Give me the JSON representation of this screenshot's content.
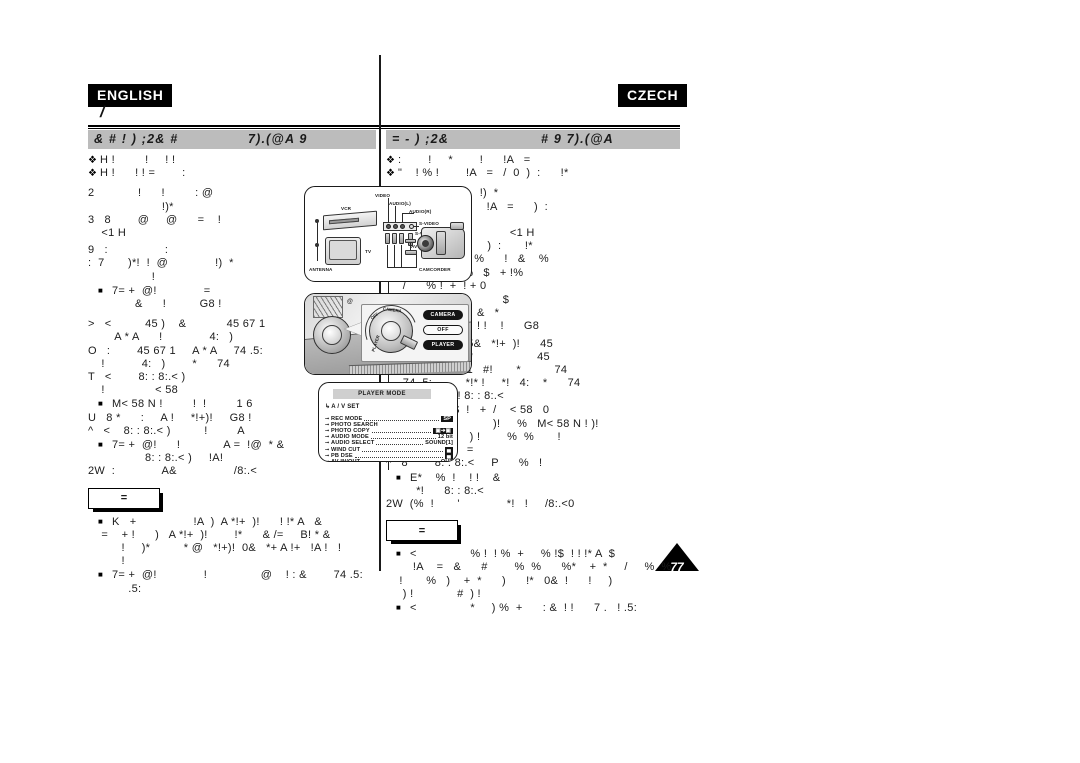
{
  "page": {
    "number": "77",
    "left_language_badge": "ENGLISH",
    "right_language_badge": "CZECH",
    "section_title": "/"
  },
  "left_column": {
    "header_main": "&  # !   )  ;2&   #",
    "header_sub": "7).(@A   9",
    "lines": [
      {
        "style": "bullet-d",
        "text": "H !         !     ! !"
      },
      {
        "style": "bullet-d",
        "text": "H !      ! ! =        :"
      },
      {
        "style": "gap",
        "text": "2             !      !         : @"
      },
      {
        "style": "plain",
        "text": "                      !)*"
      },
      {
        "style": "plain",
        "text": "3   8        @     @      =    !"
      },
      {
        "style": "plain",
        "text": "    <1 H"
      },
      {
        "style": "gap-s",
        "text": "9   :                 :"
      },
      {
        "style": "plain",
        "text": ":  7       )*!  !  @              !)  *"
      },
      {
        "style": "plain",
        "text": "                   !"
      },
      {
        "style": "bullet-sq",
        "text": "7= +  @!              ="
      },
      {
        "style": "plain",
        "text": "              &      !          G8 !"
      },
      {
        "style": "gap",
        "text": ">   <          45 )    &            45 67 1"
      },
      {
        "style": "plain",
        "text": "        A * A      !              4:   )"
      },
      {
        "style": "plain",
        "text": "O   :        45 67 1     A * A     74 .5:"
      },
      {
        "style": "plain",
        "text": "    !           4:   )        *      74"
      },
      {
        "style": "plain",
        "text": "T   <        8: : 8:.< )"
      },
      {
        "style": "plain",
        "text": "    !               < 58"
      },
      {
        "style": "bullet-sq",
        "text": "M< 58 N !         !  !         1 6"
      },
      {
        "style": "plain",
        "text": "U   8 *      :     A !     *!+)!     G8 !"
      },
      {
        "style": "plain",
        "text": "^   <    8: : 8:.< )          !         A"
      },
      {
        "style": "bullet-sq",
        "text": "7= +  @!      !             A =  !@  * &"
      },
      {
        "style": "plain",
        "text": "                 8: : 8:.< )     !A!"
      },
      {
        "style": "plain",
        "text": "2W  :              A&                 /8:.<"
      }
    ],
    "notes_label": "=",
    "notes_lines": [
      {
        "style": "bullet-sq",
        "text": "K   +                 !A  )  A *!+  )!      ! !* A   &"
      },
      {
        "style": "plain",
        "text": "    =    + !      )   A *!+  )!        !*      & /=     B! * &"
      },
      {
        "style": "plain",
        "text": "          !     )*          * @   *!+)!  0&   *+ A !+   !A !   !"
      },
      {
        "style": "plain",
        "text": "          !"
      },
      {
        "style": "bullet-sq",
        "text": "7= +  @!              !                @    ! : &        74 .5:"
      },
      {
        "style": "plain",
        "text": "            .5:"
      }
    ]
  },
  "right_column": {
    "header_main": "=           -    )  ;2&",
    "header_sub": "#  9 7).(@A",
    "lines": [
      {
        "style": "bullet-d",
        "text": ":        !     *        !      !A   ="
      },
      {
        "style": "bullet-d",
        "text": "\"    ! % !        !A   =   /  0  )  :      !*"
      },
      {
        "style": "gap",
        "text": "2   <                     !)  *"
      },
      {
        "style": "plain",
        "text": "                 !            !A   =      )  :"
      },
      {
        "style": "plain",
        "text": "             !*"
      },
      {
        "style": "plain",
        "text": "3        !                          <1 H"
      },
      {
        "style": "plain",
        "text": "9   (!          !A   =     )  :       !*"
      },
      {
        "style": "plain",
        "text": ":   6       !  + *      %      !   &    %"
      },
      {
        "style": "plain",
        "text": "            !   !      %   $   + !%"
      },
      {
        "style": "plain",
        "text": "     /      % !  +  ! + 0"
      },
      {
        "style": "bullet-sq",
        "text": "E*  !  % !              $"
      },
      {
        "style": "plain",
        "text": "              !A     =   &   *"
      },
      {
        "style": "plain",
        "text": "              !A    =    ! !    !      G8"
      },
      {
        "style": "gap-s",
        "text": ">     8        *!   45&   *!+  )!      45"
      },
      {
        "style": "plain",
        "text": "     67 1    #!      *                   45"
      },
      {
        "style": "plain",
        "text": "O   . %'   45 67 1   #!       *          74"
      },
      {
        "style": "plain",
        "text": "     74 .5:          *!* !     *!   4:    *      74"
      },
      {
        "style": "plain",
        "text": "T   8         *!   ! 8: : 8:.<"
      },
      {
        "style": "plain",
        "text": "          %   !   $  !   +  /    < 58   0"
      },
      {
        "style": "bullet-sq",
        "text": "4! 1 6                )!     %   M< 58 N ! )!"
      },
      {
        "style": "plain",
        "text": "U   ( *  :     A !    ) !        %  %       !"
      },
      {
        "style": "plain",
        "text": "                !A     ="
      },
      {
        "style": "plain",
        "text": "^   8        8: : 8:.<     P      %   !"
      },
      {
        "style": "bullet-sq",
        "text": "E*    %  !    ! !    &"
      },
      {
        "style": "plain",
        "text": "         *!      8: : 8:.<"
      },
      {
        "style": "plain",
        "text": "2W  (%  !       '              *!   !     /8:.<0"
      }
    ],
    "notes_label": "=",
    "notes_lines": [
      {
        "style": "bullet-sq",
        "text": "<                % !  ! %  +     % !$  ! ! !* A  $"
      },
      {
        "style": "plain",
        "text": "        !A    =   &      #        %  %      %*    +  *     /     %  %"
      },
      {
        "style": "plain",
        "text": "    !       %   )    +  *      )      !*   0&  !      !     )"
      },
      {
        "style": "plain",
        "text": "     ) !             #  ) !"
      },
      {
        "style": "bullet-sq",
        "text": "<                *     ) %  +      : &  ! !      7 .   ! .5:"
      }
    ]
  },
  "diagrams": {
    "connection": {
      "name": "connection-diagram",
      "labels": {
        "vcr": "VCR",
        "tv": "TV",
        "antenna": "ANTENNA",
        "video": "VIDEO",
        "audio_l": "AUDIO(L)",
        "audio_r": "AUDIO(R)",
        "s_video_jack": "S-VIDEO",
        "s_video_cable": "S-VIDEO",
        "av": "AV",
        "camcorder": "CAMCORDER"
      }
    },
    "mode_dial": {
      "name": "mode-dial-diagram",
      "pills": [
        "CAMERA",
        "OFF",
        "PLAYER"
      ],
      "dial_arc_text": "PLAYER   OFF   CAMERA"
    },
    "osd_menu": {
      "name": "player-mode-osd",
      "title": "PLAYER MODE",
      "submenu": "A / V SET",
      "rows": [
        {
          "marker": "⊸",
          "name": "REC MODE",
          "value": "SP",
          "inverted": true,
          "dots": true
        },
        {
          "marker": "⊸",
          "name": "PHOTO SEARCH",
          "value": "",
          "inverted": false,
          "dots": false
        },
        {
          "marker": "⊸",
          "name": "PHOTO COPY",
          "value": "▣➔▣",
          "inverted": true,
          "dots": true
        },
        {
          "marker": "⊸",
          "name": "AUDIO MODE",
          "value": "12 bit",
          "inverted": false,
          "dots": true
        },
        {
          "marker": "⊸",
          "name": "AUDIO SELECT",
          "value": "SOUND[1]",
          "inverted": false,
          "dots": true
        },
        {
          "marker": "⊸",
          "name": "WIND CUT",
          "value": "▄",
          "inverted": true,
          "dots": true
        },
        {
          "marker": "⊸",
          "name": "PB DSE",
          "value": "▄",
          "inverted": true,
          "dots": true
        },
        {
          "marker": "⊸",
          "name": "AV IN/OUT",
          "value": "OUT",
          "inverted": false,
          "dots": true
        }
      ]
    }
  },
  "colors": {
    "header_bar": "#bcbcbc",
    "badge_bg": "#000000",
    "text": "#1b1b1b",
    "rule": "#000000"
  }
}
